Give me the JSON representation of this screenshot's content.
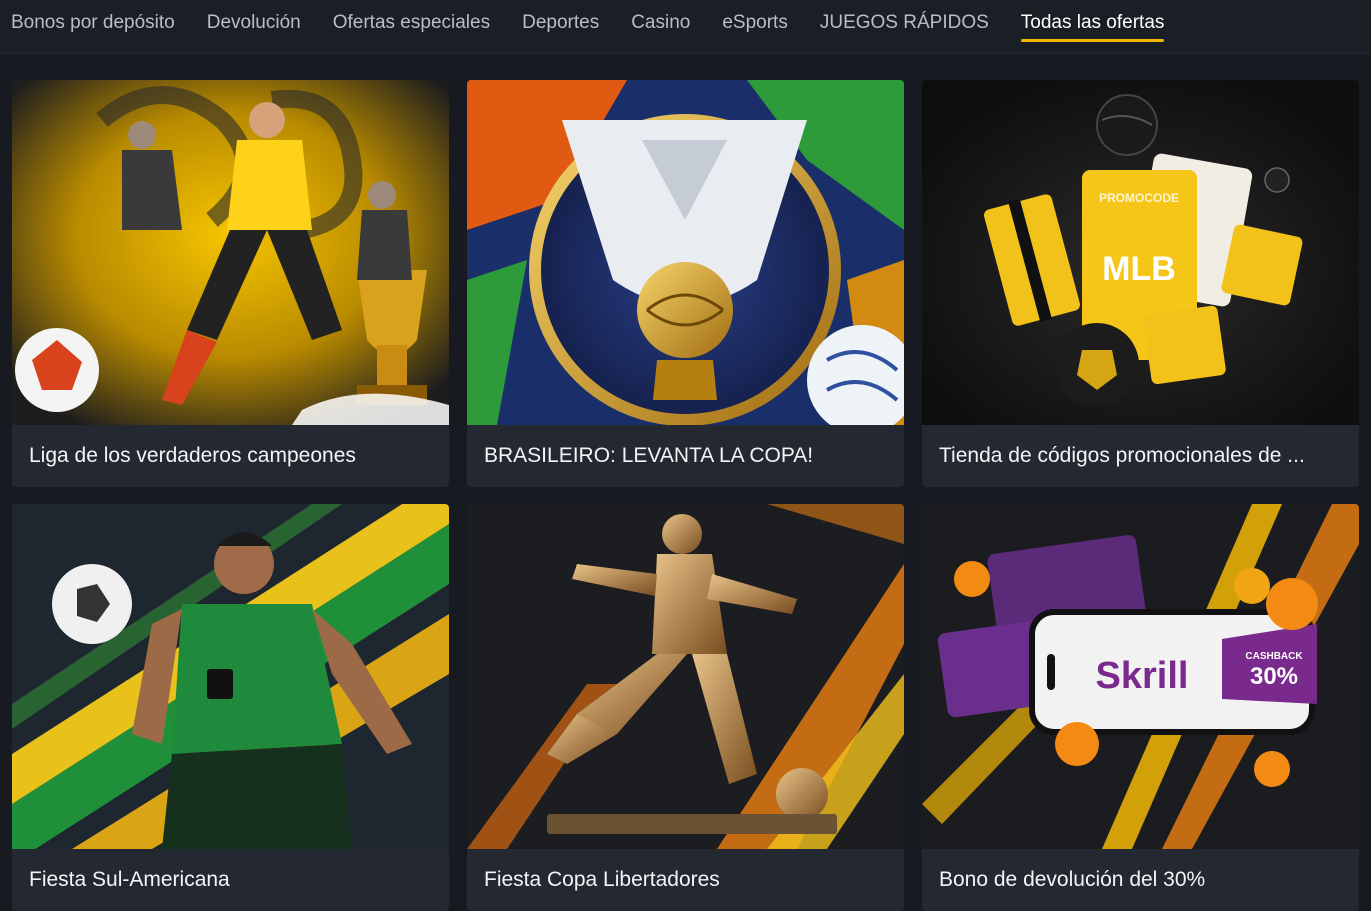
{
  "tabs": [
    {
      "label": "Bonos por depósito",
      "active": false
    },
    {
      "label": "Devolución",
      "active": false
    },
    {
      "label": "Ofertas especiales",
      "active": false
    },
    {
      "label": "Deportes",
      "active": false
    },
    {
      "label": "Casino",
      "active": false
    },
    {
      "label": "eSports",
      "active": false
    },
    {
      "label": "JUEGOS RÁPIDOS",
      "active": false
    },
    {
      "label": "Todas las ofertas",
      "active": true
    }
  ],
  "accent_color": "#f2b705",
  "offers": [
    {
      "title": "Liga de los verdaderos campeones",
      "image": "football-players-trophy-illustration"
    },
    {
      "title": "BRASILEIRO: LEVANTA LA COPA!",
      "image": "brasileiro-trophy-illustration"
    },
    {
      "title": "Tienda de códigos promocionales de ...",
      "image": "promocode-gifts-illustration",
      "card_text": [
        "PROMOCODE",
        "MLB"
      ]
    },
    {
      "title": "Fiesta Sul-Americana",
      "image": "player-green-jersey-illustration"
    },
    {
      "title": "Fiesta Copa Libertadores",
      "image": "golden-player-statue-illustration"
    },
    {
      "title": "Bono de devolución del 30%",
      "image": "skrill-cashback-illustration",
      "card_text": [
        "Skrill",
        "CASHBACK",
        "30%"
      ]
    }
  ]
}
